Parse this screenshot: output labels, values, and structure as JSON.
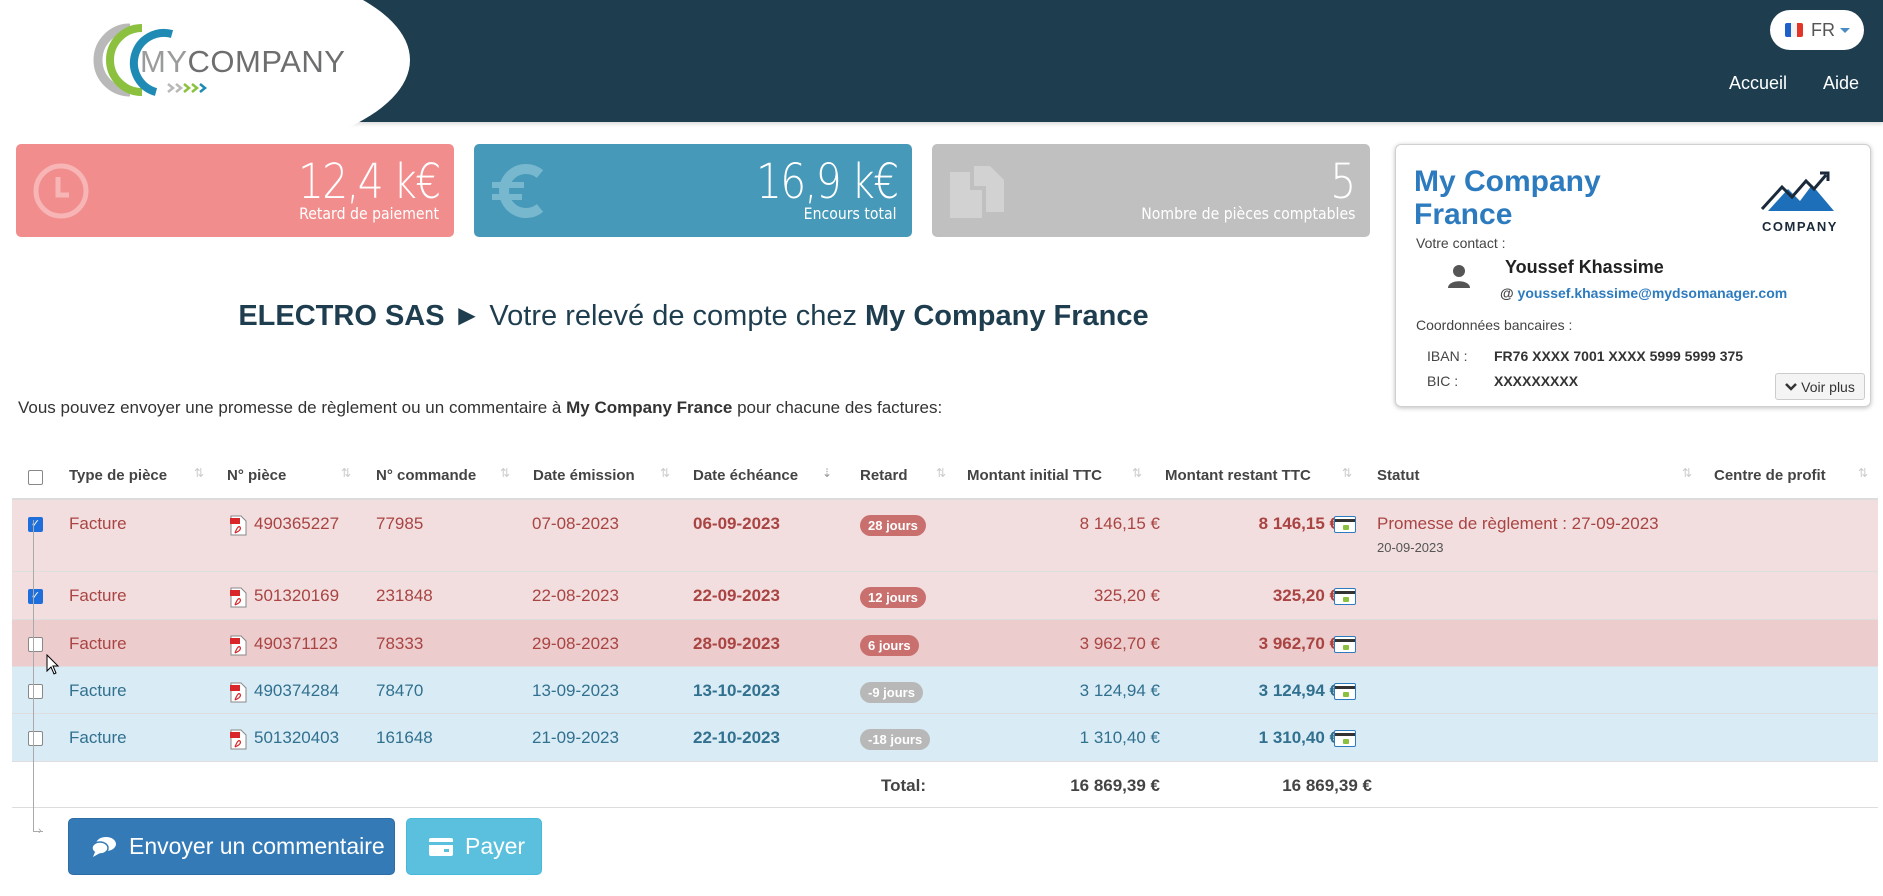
{
  "header": {
    "logo": {
      "prefix": "MY",
      "name": "COMPANY"
    },
    "language": {
      "code": "FR",
      "flag_colors": [
        "#1e5fc9",
        "#ffffff",
        "#e3342a"
      ]
    },
    "nav": [
      {
        "label": "Accueil"
      },
      {
        "label": "Aide"
      }
    ]
  },
  "stats": [
    {
      "value": "12,4 k€",
      "label": "Retard de paiement",
      "icon": "clock-icon",
      "color": "#f28d8d"
    },
    {
      "value": "16,9 k€",
      "label": "Encours total",
      "icon": "euro-icon",
      "color": "#4699b8"
    },
    {
      "value": "5",
      "label": "Nombre de pièces comptables",
      "icon": "documents-icon",
      "color": "#c0c0c0"
    }
  ],
  "company_card": {
    "name_line1": "My Company",
    "name_line2": "France",
    "logo_text": "COMPANY",
    "contact_label": "Votre contact :",
    "contact_name": "Youssef Khassime",
    "contact_at": "@",
    "contact_email": "youssef.khassime@mydsomanager.com",
    "bank_label": "Coordonnées bancaires :",
    "iban_label": "IBAN :",
    "iban": "FR76 XXXX 7001 XXXX 5999 5999 375",
    "bic_label": "BIC :",
    "bic": "XXXXXXXXX",
    "more_label": "Voir plus"
  },
  "title": {
    "client": "ELECTRO SAS",
    "arrow": "►",
    "middle": " Votre relevé de compte chez ",
    "company": "My Company France"
  },
  "intro": {
    "before": "Vous pouvez envoyer une promesse de règlement ou un commentaire à ",
    "company": "My Company France",
    "after": " pour chacune des factures:"
  },
  "table": {
    "columns": [
      "Type de pièce",
      "N° pièce",
      "N° commande",
      "Date émission",
      "Date échéance",
      "Retard",
      "Montant initial TTC",
      "Montant restant TTC",
      "Statut",
      "Centre de profit"
    ],
    "rows": [
      {
        "checked": true,
        "type": "Facture",
        "piece": "490365227",
        "commande": "77985",
        "emission": "07-08-2023",
        "echeance": "06-09-2023",
        "retard": "28 jours",
        "initial": "8 146,15 €",
        "restant": "8 146,15 €",
        "statut": "Promesse de règlement : 27-09-2023",
        "statut_date": "20-09-2023",
        "centre": "",
        "state": "late"
      },
      {
        "checked": true,
        "type": "Facture",
        "piece": "501320169",
        "commande": "231848",
        "emission": "22-08-2023",
        "echeance": "22-09-2023",
        "retard": "12 jours",
        "initial": "325,20 €",
        "restant": "325,20 €",
        "statut": "",
        "statut_date": "",
        "centre": "",
        "state": "late"
      },
      {
        "checked": false,
        "type": "Facture",
        "piece": "490371123",
        "commande": "78333",
        "emission": "29-08-2023",
        "echeance": "28-09-2023",
        "retard": "6 jours",
        "initial": "3 962,70 €",
        "restant": "3 962,70 €",
        "statut": "",
        "statut_date": "",
        "centre": "",
        "state": "late-hover"
      },
      {
        "checked": false,
        "type": "Facture",
        "piece": "490374284",
        "commande": "78470",
        "emission": "13-09-2023",
        "echeance": "13-10-2023",
        "retard": "-9 jours",
        "initial": "3 124,94 €",
        "restant": "3 124,94 €",
        "statut": "",
        "statut_date": "",
        "centre": "",
        "state": "upcoming"
      },
      {
        "checked": false,
        "type": "Facture",
        "piece": "501320403",
        "commande": "161648",
        "emission": "21-09-2023",
        "echeance": "22-10-2023",
        "retard": "-18 jours",
        "initial": "1 310,40 €",
        "restant": "1 310,40 €",
        "statut": "",
        "statut_date": "",
        "centre": "",
        "state": "upcoming"
      }
    ],
    "total_label": "Total:",
    "total_initial": "16 869,39 €",
    "total_restant": "16 869,39 €"
  },
  "actions": {
    "comment_label": "Envoyer un commentaire",
    "pay_label": "Payer"
  }
}
